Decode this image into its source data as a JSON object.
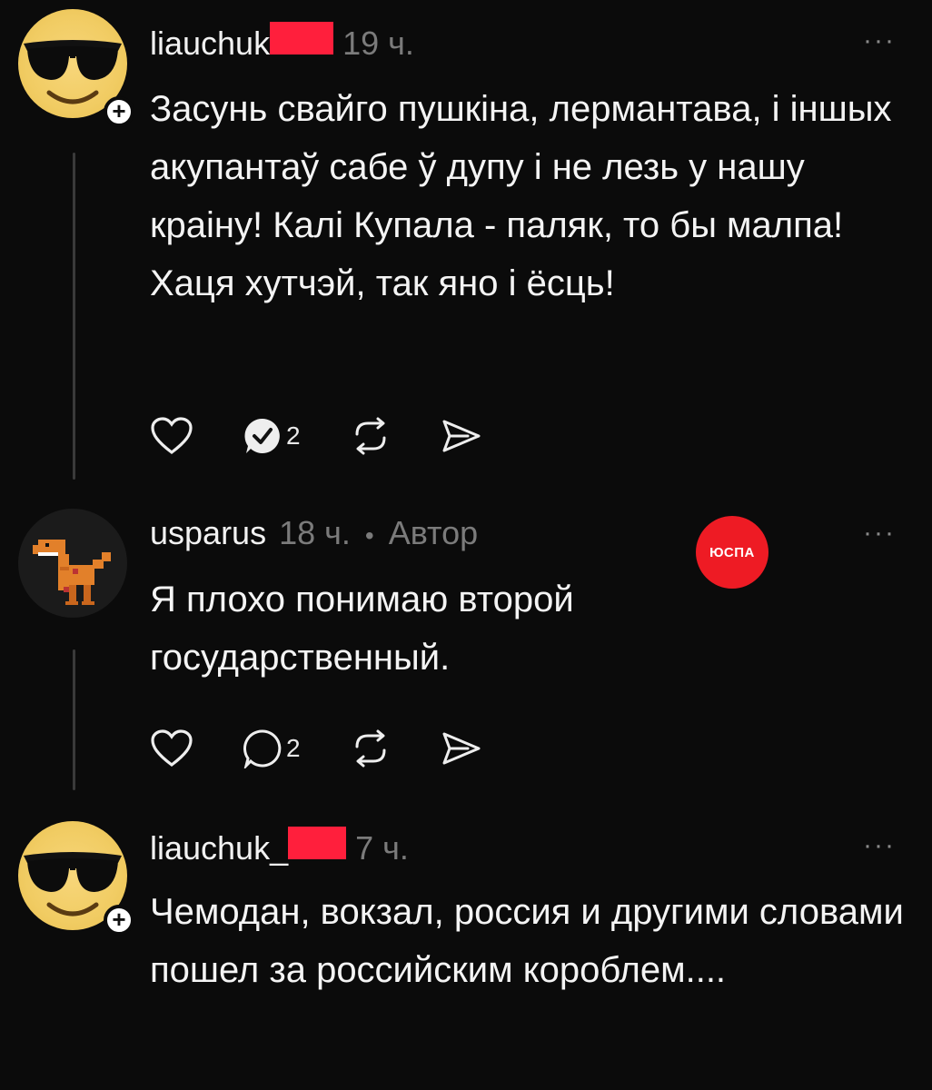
{
  "comments": [
    {
      "username": "liauchuk",
      "time": "19 ч.",
      "more_label": "···",
      "text": "Засунь свайго пушкіна, лермантава, і іншых акупантаў сабе ў дупу і не лезь у нашу краіну! Калі Купала - паляк, то бы малпа! Хаця хутчэй, так яно і ёсць!",
      "reply_count": "2",
      "avatar_icon": "sunglasses-smiley-icon"
    },
    {
      "username": "usparus",
      "time": "18 ч.",
      "separator": "•",
      "author_label": "Автор",
      "more_label": "···",
      "text": "Я плохо понимаю второй государственный.",
      "reply_count": "2",
      "avatar_icon": "pixel-dinosaur-icon",
      "stamp_text": "ЮСПА"
    },
    {
      "username": "liauchuk_",
      "time": "7 ч.",
      "more_label": "···",
      "text": "Чемодан, вокзал, россия и другими словами пошел за российским короблем....",
      "avatar_icon": "sunglasses-smiley-icon"
    }
  ],
  "colors": {
    "background": "#0b0b0b",
    "redaction": "#ff1f3c",
    "stamp": "#ee1b24",
    "meta_text": "#7b7b7b"
  }
}
